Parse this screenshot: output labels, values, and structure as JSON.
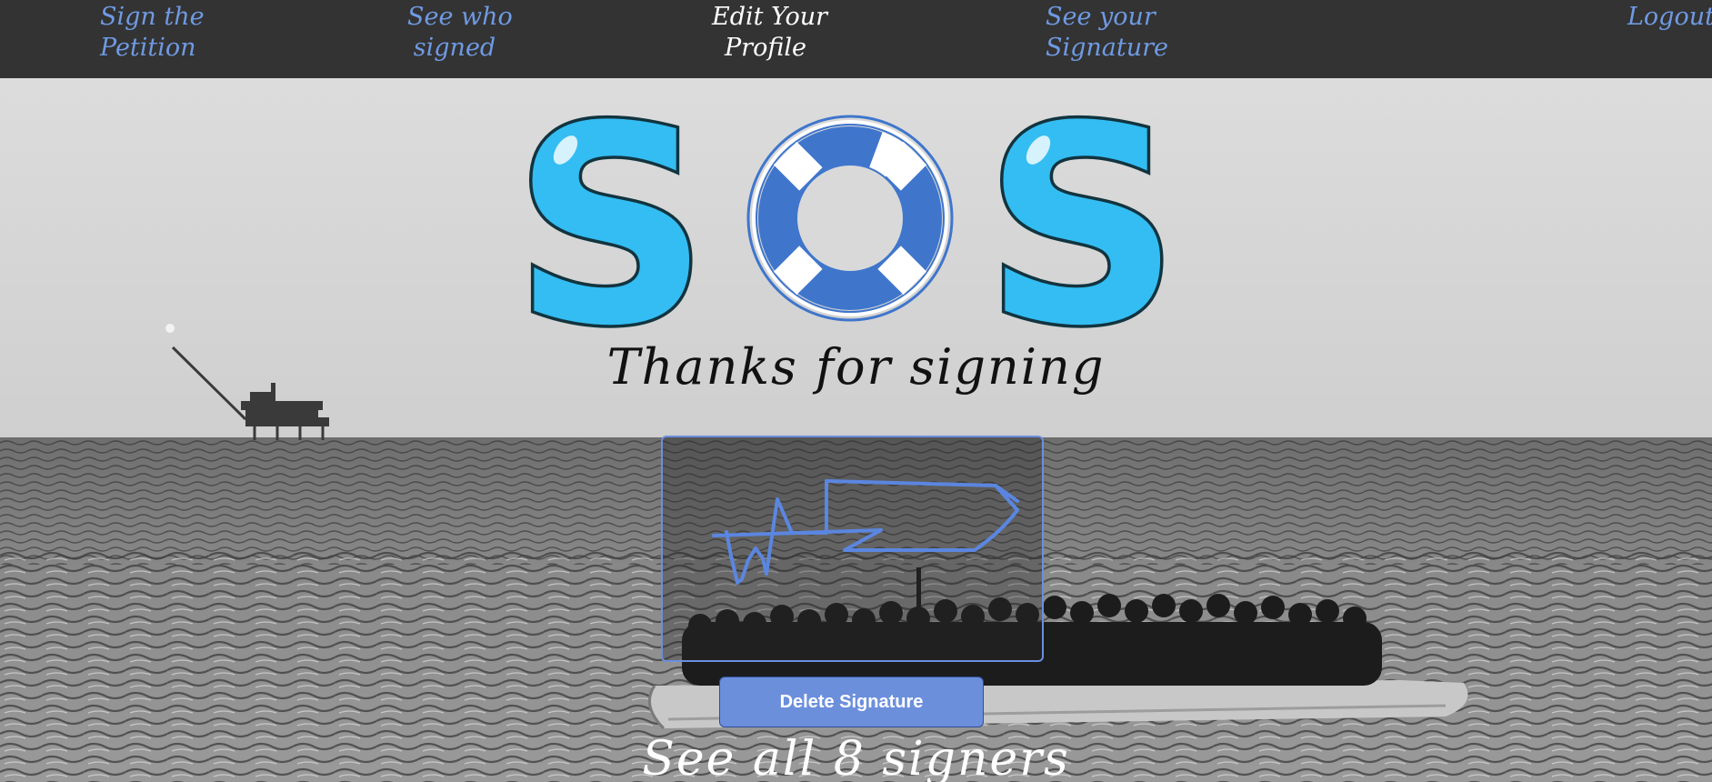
{
  "nav": {
    "items": [
      {
        "line1": "Sign the",
        "line2": "Petition"
      },
      {
        "line1": "See who",
        "line2": "signed"
      },
      {
        "line1": "Edit Your",
        "line2": "Profile"
      },
      {
        "line1": "See your",
        "line2": "Signature"
      },
      {
        "line1": "Logout",
        "line2": ""
      }
    ],
    "link_color": "#6f9ae3",
    "active_color": "#ffffff",
    "background": "#333333"
  },
  "logo": {
    "text_left": "S",
    "text_right": "S",
    "ring_icon": "lifebuoy-icon",
    "letter_color": "#33bdf2",
    "ring_color": "#3f76cc"
  },
  "main": {
    "thanks_text": "Thanks for signing",
    "delete_button_label": "Delete Signature",
    "see_all_text": "See all 8 signers"
  },
  "signature": {
    "stroke_color": "#5b86e0",
    "border_color": "#6b8fdf"
  }
}
